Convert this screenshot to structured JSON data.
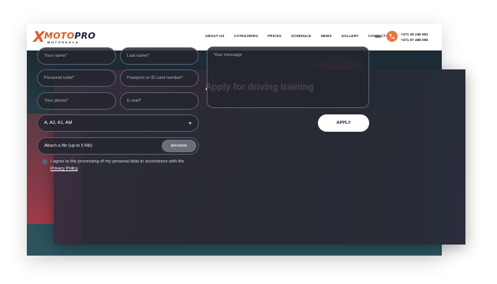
{
  "site": {
    "logo": {
      "mark": "X",
      "word_part1": "MOTO",
      "word_part2": "PRO",
      "tagline": "MOTOSKOLA"
    },
    "nav": [
      "ABOUT US",
      "CATEGORIES",
      "PRICES",
      "SCHEDULE",
      "NEWS",
      "GALLERY",
      "CONTACTS"
    ],
    "language": "EN",
    "phones": [
      "+371 29 245 991",
      "+371 67 468 055"
    ],
    "accent_color": "#e8773f"
  },
  "modal": {
    "title": "Apply for driving training",
    "fields": {
      "first_name_placeholder": "Your name*",
      "last_name_placeholder": "Last name*",
      "personal_code_placeholder": "Personal code*",
      "id_number_placeholder": "Passport or ID card number*",
      "phone_placeholder": "Your phone*",
      "email_placeholder": "E-mail*",
      "message_placeholder": "Your message"
    },
    "category_select": {
      "value": "A, A2, A1, AM"
    },
    "attach": {
      "label": "Attach a file (up to 5 Mb)",
      "browse_label": "BROWSE"
    },
    "consent": {
      "text": "I agree to the processing of my personal data in accordance with the",
      "link": "Privacy Policy",
      "suffix": "."
    },
    "apply_label": "APPLY"
  }
}
